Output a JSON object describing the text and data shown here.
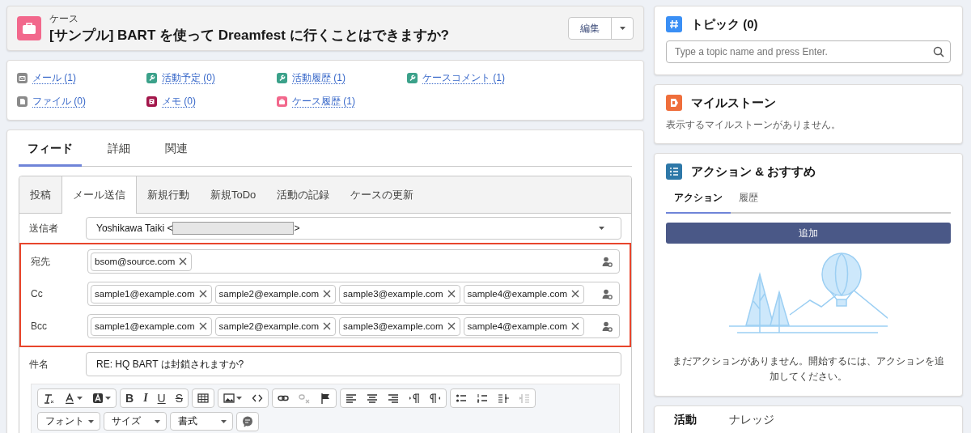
{
  "header": {
    "object_label": "ケース",
    "title": "[サンプル] BART を使って Dreamfest に行くことはできますか?",
    "edit_button": "編集"
  },
  "related_links": [
    {
      "label": "メール (1)",
      "color": "#8a8a8a"
    },
    {
      "label": "活動予定 (0)",
      "color": "#3ba18a"
    },
    {
      "label": "活動履歴 (1)",
      "color": "#3ba18a"
    },
    {
      "label": "ケースコメント (1)",
      "color": "#3ba18a"
    },
    {
      "label": "ファイル (0)",
      "color": "#8a8a8a"
    },
    {
      "label": "メモ (0)",
      "color": "#a3174b"
    },
    {
      "label": "ケース履歴 (1)",
      "color": "#f2688c"
    }
  ],
  "feed_tabs": [
    {
      "label": "フィード",
      "selected": true
    },
    {
      "label": "詳細",
      "selected": false
    },
    {
      "label": "関連",
      "selected": false
    }
  ],
  "publisher_tabs": [
    {
      "label": "投稿",
      "selected": false
    },
    {
      "label": "メール送信",
      "selected": true
    },
    {
      "label": "新規行動",
      "selected": false
    },
    {
      "label": "新規ToDo",
      "selected": false
    },
    {
      "label": "活動の記録",
      "selected": false
    },
    {
      "label": "ケースの更新",
      "selected": false
    }
  ],
  "sender": {
    "label": "送信者",
    "value_start": "Yoshikawa Taiki <",
    "value_end": ">"
  },
  "recipients": [
    {
      "label": "宛先",
      "addresses": [
        "bsom@source.com"
      ]
    },
    {
      "label": "Cc",
      "addresses": [
        "sample1@example.com",
        "sample2@example.com",
        "sample3@example.com",
        "sample4@example.com"
      ]
    },
    {
      "label": "Bcc",
      "addresses": [
        "sample1@example.com",
        "sample2@example.com",
        "sample3@example.com",
        "sample4@example.com"
      ]
    }
  ],
  "subject": {
    "label": "件名",
    "value": "RE: HQ BART は封鎖されますか?"
  },
  "toolbar_groups": [
    [
      {
        "kind": "icon",
        "disabled": false
      },
      {
        "kind": "icon",
        "disabled": false
      },
      {
        "kind": "icon",
        "disabled": false
      }
    ],
    [
      {
        "kind": "bold",
        "label": "B",
        "disabled": false
      },
      {
        "kind": "italic",
        "label": "I",
        "disabled": false
      },
      {
        "kind": "underline",
        "label": "U",
        "disabled": false
      },
      {
        "kind": "strike",
        "label": "S",
        "disabled": false
      }
    ],
    [
      {
        "kind": "icon",
        "disabled": false
      }
    ],
    [
      {
        "kind": "icon",
        "disabled": false
      },
      {
        "kind": "icon",
        "disabled": false
      }
    ],
    [
      {
        "kind": "icon",
        "disabled": false
      },
      {
        "kind": "icon",
        "disabled": true
      },
      {
        "kind": "icon",
        "disabled": false
      }
    ],
    [
      {
        "kind": "icon",
        "disabled": false
      },
      {
        "kind": "icon",
        "disabled": false
      },
      {
        "kind": "icon",
        "disabled": false
      },
      {
        "kind": "icon",
        "disabled": false
      },
      {
        "kind": "icon",
        "disabled": false
      }
    ],
    [
      {
        "kind": "icon",
        "disabled": false
      },
      {
        "kind": "icon",
        "disabled": false
      },
      {
        "kind": "icon",
        "disabled": false
      },
      {
        "kind": "icon",
        "disabled": true
      }
    ]
  ],
  "toolbar_dropdowns": [
    "フォント",
    "サイズ",
    "書式"
  ],
  "topics": {
    "title": "トピック (0)",
    "placeholder": "Type a topic name and press Enter."
  },
  "milestones": {
    "title": "マイルストーン",
    "empty_text": "表示するマイルストーンがありません。"
  },
  "actions": {
    "title": "アクション & おすすめ",
    "tabs": [
      {
        "label": "アクション",
        "selected": true
      },
      {
        "label": "履歴",
        "selected": false
      }
    ],
    "add_button": "追加",
    "empty_text": "まだアクションがありません。開始するには、アクションを追加してください。"
  },
  "activity_tabs": [
    {
      "label": "活動",
      "selected": true
    },
    {
      "label": "ナレッジ",
      "selected": false
    }
  ]
}
